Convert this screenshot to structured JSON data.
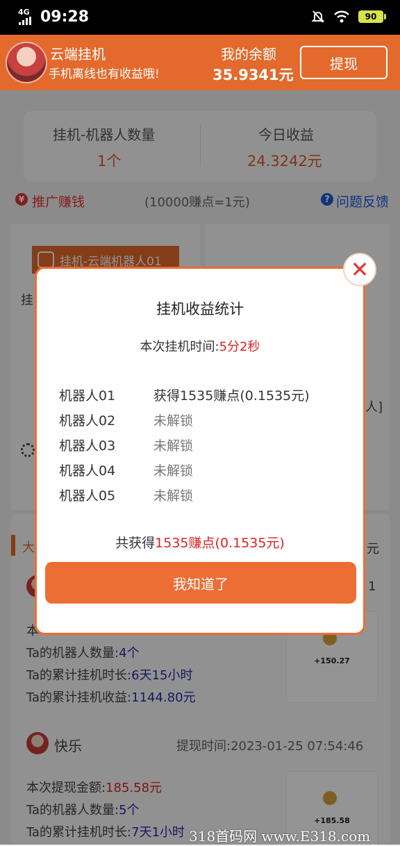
{
  "status_bar": {
    "network": "4G",
    "time": "09:28",
    "battery": "90"
  },
  "header": {
    "app_name": "云端挂机",
    "subtitle": "手机离线也有收益哦!",
    "balance_label": "我的余额",
    "balance_value": "35.9341元",
    "withdraw_label": "提现"
  },
  "stats": {
    "robot_label": "挂机-机器人数量",
    "robot_value": "1个",
    "today_label": "今日收益",
    "today_value": "24.3242元"
  },
  "promo": {
    "icon": "¥",
    "label": "推广赚钱",
    "rate": "(10000赚点=1元)",
    "help_label": "问题反馈"
  },
  "background": {
    "robot_tag": "挂机-云端机器人01",
    "card_text_1": "挂",
    "card_text_2": "人]",
    "feed_title_frag": "大",
    "feed_right_frag": "元",
    "feed_right_frag2": "1",
    "feed_frag3": "本",
    "entry1": {
      "robots_label": "Ta的机器人数量:",
      "robots_value": "4个",
      "duration_label": "Ta的累计挂机时长:",
      "duration_value": "6天15小时",
      "income_label": "Ta的累计挂机收益:",
      "income_value": "1144.80元",
      "thumb_amount": "+150.27"
    },
    "entry2": {
      "user": "快乐",
      "time_label": "提现时间:",
      "time_value": "2023-01-25 07:54:46",
      "amount_label": "本次提现金额:",
      "amount_value": "185.58元",
      "robots_label": "Ta的机器人数量:",
      "robots_value": "5个",
      "duration_label": "Ta的累计挂机时长:",
      "duration_value": "7天1小时",
      "thumb_amount": "+185.58"
    }
  },
  "modal": {
    "title": "挂机收益统计",
    "time_label": "本次挂机时间:",
    "time_value": "5分2秒",
    "rows": [
      {
        "name": "机器人01",
        "status": "获得1535赚点(0.1535元)"
      },
      {
        "name": "机器人02",
        "status": "未解锁"
      },
      {
        "name": "机器人03",
        "status": "未解锁"
      },
      {
        "name": "机器人04",
        "status": "未解锁"
      },
      {
        "name": "机器人05",
        "status": "未解锁"
      }
    ],
    "total_prefix": "共获得",
    "total_value": "1535赚点(0.1535元)",
    "ok_label": "我知道了",
    "close_glyph": "✕"
  },
  "watermark": "318首码网 www.E318.com"
}
